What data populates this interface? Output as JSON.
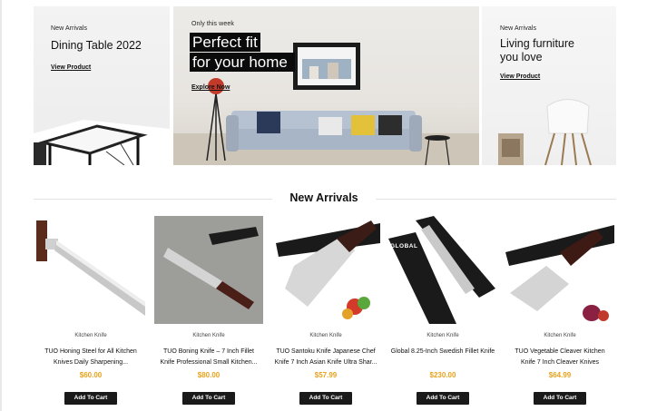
{
  "banners": [
    {
      "kicker": "New Arrivals",
      "title": "Dining Table 2022",
      "link": "View Product"
    },
    {
      "kicker": "Only this week",
      "title_line1": "Perfect fit",
      "title_line2": "for your home",
      "link": "Explore Now"
    },
    {
      "kicker": "New Arrivals",
      "title_line1": "Living furniture",
      "title_line2": "you love",
      "link": "View Product"
    }
  ],
  "section": {
    "title": "New Arrivals"
  },
  "products": [
    {
      "category": "Kitchen Knife",
      "name": "TUO Honing Steel for All Kitchen Knives Daily Sharpening...",
      "price": "$60.00",
      "button": "Add To Cart"
    },
    {
      "category": "Kitchen Knife",
      "name": "TUO Boning Knife – 7 Inch Fillet Knife Professional Small Kitchen...",
      "price": "$80.00",
      "button": "Add To Cart"
    },
    {
      "category": "Kitchen Knife",
      "name": "TUO Santoku Knife Japanese Chef Knife 7 Inch Asian Knife Ultra Shar...",
      "price": "$57.99",
      "button": "Add To Cart"
    },
    {
      "category": "Kitchen Knife",
      "name": "Global 8.25-Inch Swedish Fillet Knife",
      "price": "$230.00",
      "button": "Add To Cart"
    },
    {
      "category": "Kitchen Knife",
      "name": "TUO Vegetable Cleaver Kitchen Knife 7 Inch Cleaver Knives",
      "price": "$64.99",
      "button": "Add To Cart"
    }
  ],
  "brand_text": {
    "box4": "GLOBAL"
  },
  "colors": {
    "price": "#e8a21c",
    "button_bg": "#1a1a1a"
  }
}
